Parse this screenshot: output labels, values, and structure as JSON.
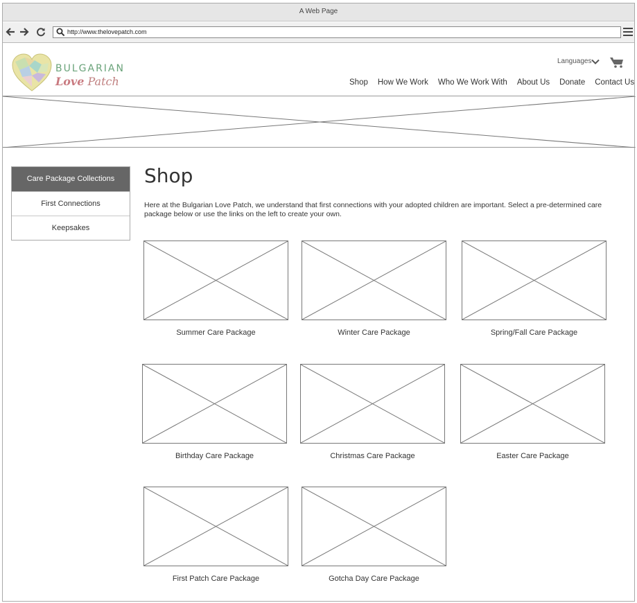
{
  "window": {
    "title": "A Web Page"
  },
  "browser": {
    "url": "http://www.thelovepatch.com",
    "icons": {
      "back": "arrow-left-icon",
      "forward": "arrow-right-icon",
      "reload": "reload-icon",
      "search": "search-icon",
      "menu": "hamburger-menu-icon"
    }
  },
  "header": {
    "logo": {
      "line1": "BULGARIAN",
      "line2_bold": "Love",
      "line2_rest": " Patch"
    },
    "languages_label": "Languages",
    "nav": [
      "Shop",
      "How We Work",
      "Who We Work With",
      "About Us",
      "Donate",
      "Contact Us"
    ],
    "icons": {
      "languages": "chevron-down-icon",
      "cart": "cart-icon"
    }
  },
  "sidebar": {
    "items": [
      {
        "label": "Care Package Collections",
        "active": true
      },
      {
        "label": "First Connections",
        "active": false
      },
      {
        "label": "Keepsakes",
        "active": false
      }
    ]
  },
  "main": {
    "title": "Shop",
    "intro": "Here at the Bulgarian Love Patch, we understand that first connections with your adopted children are important. Select a pre-determined care package below or use the links on the left to create your own.",
    "products": [
      {
        "label": "Summer Care Package"
      },
      {
        "label": "Winter Care Package"
      },
      {
        "label": "Spring/Fall Care Package"
      },
      {
        "label": "Birthday Care Package"
      },
      {
        "label": "Christmas Care Package"
      },
      {
        "label": "Easter Care Package"
      },
      {
        "label": "First Patch Care Package"
      },
      {
        "label": "Gotcha Day Care Package"
      }
    ]
  },
  "colors": {
    "sidebar_active_bg": "#666666",
    "logo_green": "#6aa37a",
    "logo_pink": "#c97a80"
  }
}
